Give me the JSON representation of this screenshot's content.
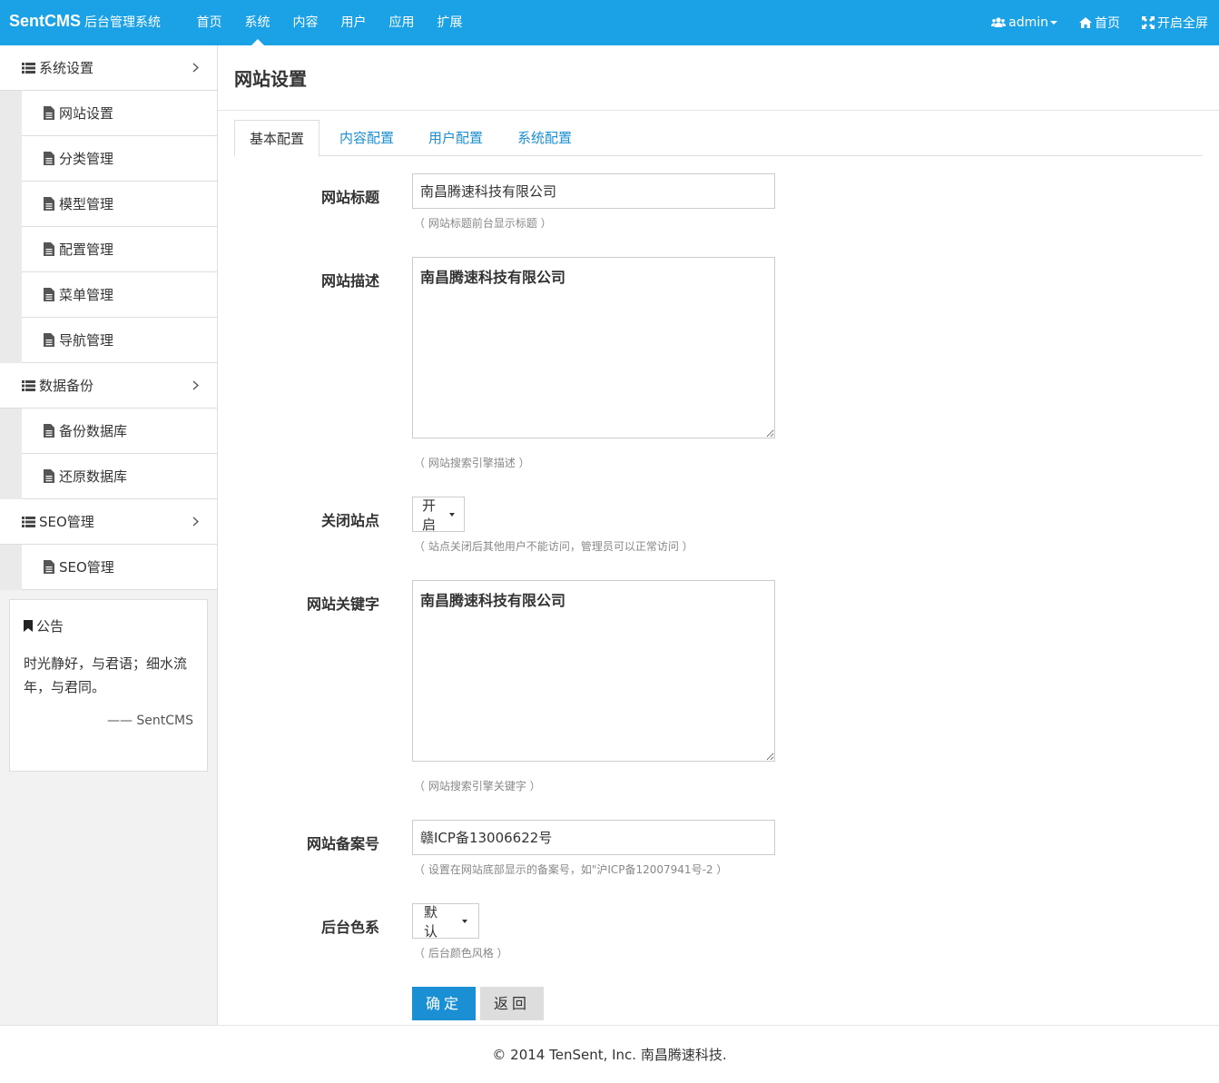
{
  "brand": {
    "main": "SentCMS",
    "sub": "后台管理系统"
  },
  "nav": [
    {
      "label": "首页"
    },
    {
      "label": "系统"
    },
    {
      "label": "内容"
    },
    {
      "label": "用户"
    },
    {
      "label": "应用"
    },
    {
      "label": "扩展"
    }
  ],
  "nav_right": {
    "user": "admin",
    "home": "首页",
    "fullscreen": "开启全屏"
  },
  "sidebar": {
    "groups": [
      {
        "label": "系统设置",
        "items": [
          "网站设置",
          "分类管理",
          "模型管理",
          "配置管理",
          "菜单管理",
          "导航管理"
        ]
      },
      {
        "label": "数据备份",
        "items": [
          "备份数据库",
          "还原数据库"
        ]
      },
      {
        "label": "SEO管理",
        "items": [
          "SEO管理"
        ]
      }
    ],
    "notice": {
      "title": "公告",
      "body": "时光静好，与君语；细水流年，与君同。",
      "sign": "—— SentCMS"
    }
  },
  "page": {
    "title": "网站设置"
  },
  "tabs": [
    "基本配置",
    "内容配置",
    "用户配置",
    "系统配置"
  ],
  "form": {
    "title": {
      "label": "网站标题",
      "value": "南昌腾速科技有限公司",
      "help": "（ 网站标题前台显示标题 ）"
    },
    "description": {
      "label": "网站描述",
      "value": "南昌腾速科技有限公司",
      "help": "（ 网站搜索引擎描述 ）"
    },
    "close_site": {
      "label": "关闭站点",
      "value": "开启",
      "help": "（ 站点关闭后其他用户不能访问，管理员可以正常访问 ）"
    },
    "keywords": {
      "label": "网站关键字",
      "value": "南昌腾速科技有限公司",
      "help": "（ 网站搜索引擎关键字 ）"
    },
    "icp": {
      "label": "网站备案号",
      "value": "赣ICP备13006622号",
      "help": "（ 设置在网站底部显示的备案号，如\"沪ICP备12007941号-2 ）"
    },
    "color": {
      "label": "后台色系",
      "value": "默认",
      "help": "（ 后台颜色风格 ）"
    },
    "submit": "确定",
    "back": "返回"
  },
  "footer": "© 2014 TenSent, Inc. 南昌腾速科技.",
  "colors": {
    "primary": "#1aa1e6",
    "button": "#1a8fd3"
  }
}
